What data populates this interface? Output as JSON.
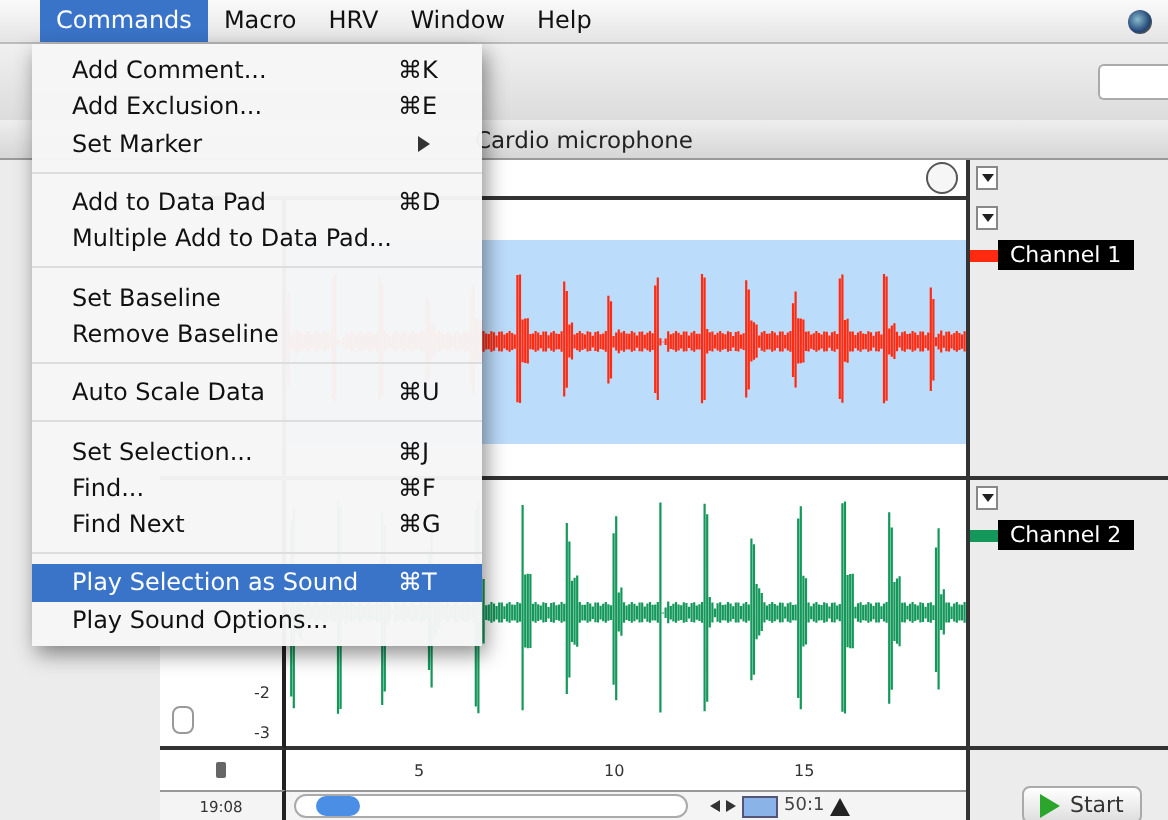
{
  "menubar": [
    {
      "label": "Commands",
      "selected": true
    },
    {
      "label": "Macro",
      "selected": false
    },
    {
      "label": "HRV",
      "selected": false
    },
    {
      "label": "Window",
      "selected": false
    },
    {
      "label": "Help",
      "selected": false
    }
  ],
  "menu": [
    {
      "kind": "item",
      "label": "Add Comment...",
      "shortcut": "⌘K",
      "selected": false
    },
    {
      "kind": "item",
      "label": "Add Exclusion...",
      "shortcut": "⌘E",
      "selected": false
    },
    {
      "kind": "submenu",
      "label": "Set Marker",
      "selected": false
    },
    {
      "kind": "separator"
    },
    {
      "kind": "item",
      "label": "Add to Data Pad",
      "shortcut": "⌘D",
      "selected": false
    },
    {
      "kind": "item",
      "label": "Multiple Add to Data Pad...",
      "selected": false
    },
    {
      "kind": "separator"
    },
    {
      "kind": "item",
      "label": "Set Baseline",
      "selected": false
    },
    {
      "kind": "item",
      "label": "Remove Baseline",
      "selected": false
    },
    {
      "kind": "separator"
    },
    {
      "kind": "item",
      "label": "Auto Scale Data",
      "shortcut": "⌘U",
      "selected": false
    },
    {
      "kind": "separator"
    },
    {
      "kind": "item",
      "label": "Set Selection...",
      "shortcut": "⌘J",
      "selected": false
    },
    {
      "kind": "item",
      "label": "Find...",
      "shortcut": "⌘F",
      "selected": false
    },
    {
      "kind": "item",
      "label": "Find Next",
      "shortcut": "⌘G",
      "selected": false
    },
    {
      "kind": "separator"
    },
    {
      "kind": "item",
      "label": "Play Selection as Sound",
      "shortcut": "⌘T",
      "selected": true
    },
    {
      "kind": "item",
      "label": "Play Sound Options...",
      "selected": false
    }
  ],
  "window": {
    "title": "Cardio microphone"
  },
  "channels": [
    {
      "name": "Channel 1",
      "color": "#ff2a10"
    },
    {
      "name": "Channel 2",
      "color": "#14985a",
      "y_ticks": [
        "-2",
        "-3"
      ]
    }
  ],
  "x_ticks": [
    "5",
    "10",
    "15"
  ],
  "time_field": "19:08",
  "zoom_ratio": "50:1",
  "start_button": "Start"
}
